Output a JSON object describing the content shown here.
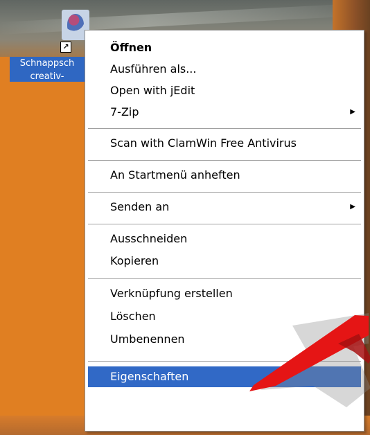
{
  "desktop": {
    "icon": {
      "name": "shortcut-icon",
      "label_line1": "Schnappsch",
      "label_line2": "creativ-"
    },
    "accent_color": "#e07f22"
  },
  "context_menu": {
    "items": [
      {
        "label": "Öffnen",
        "bold": true
      },
      {
        "label": "Ausführen als..."
      },
      {
        "label": "Open with jEdit"
      },
      {
        "label": "7-Zip",
        "submenu": true
      },
      {
        "label": "Scan with ClamWin Free Antivirus"
      },
      {
        "label": "An Startmenü anheften"
      },
      {
        "label": "Senden an",
        "submenu": true
      },
      {
        "label": "Ausschneiden"
      },
      {
        "label": "Kopieren"
      },
      {
        "label": "Verknüpfung erstellen"
      },
      {
        "label": "Löschen"
      },
      {
        "label": "Umbenennen"
      },
      {
        "label": "Eigenschaften",
        "selected": true
      }
    ],
    "submenu_icon": "chevron-right-icon",
    "selected_color": "#3169c6"
  },
  "annotation": {
    "type": "red-arrow",
    "color": "#e01616",
    "points_to": "Eigenschaften"
  }
}
